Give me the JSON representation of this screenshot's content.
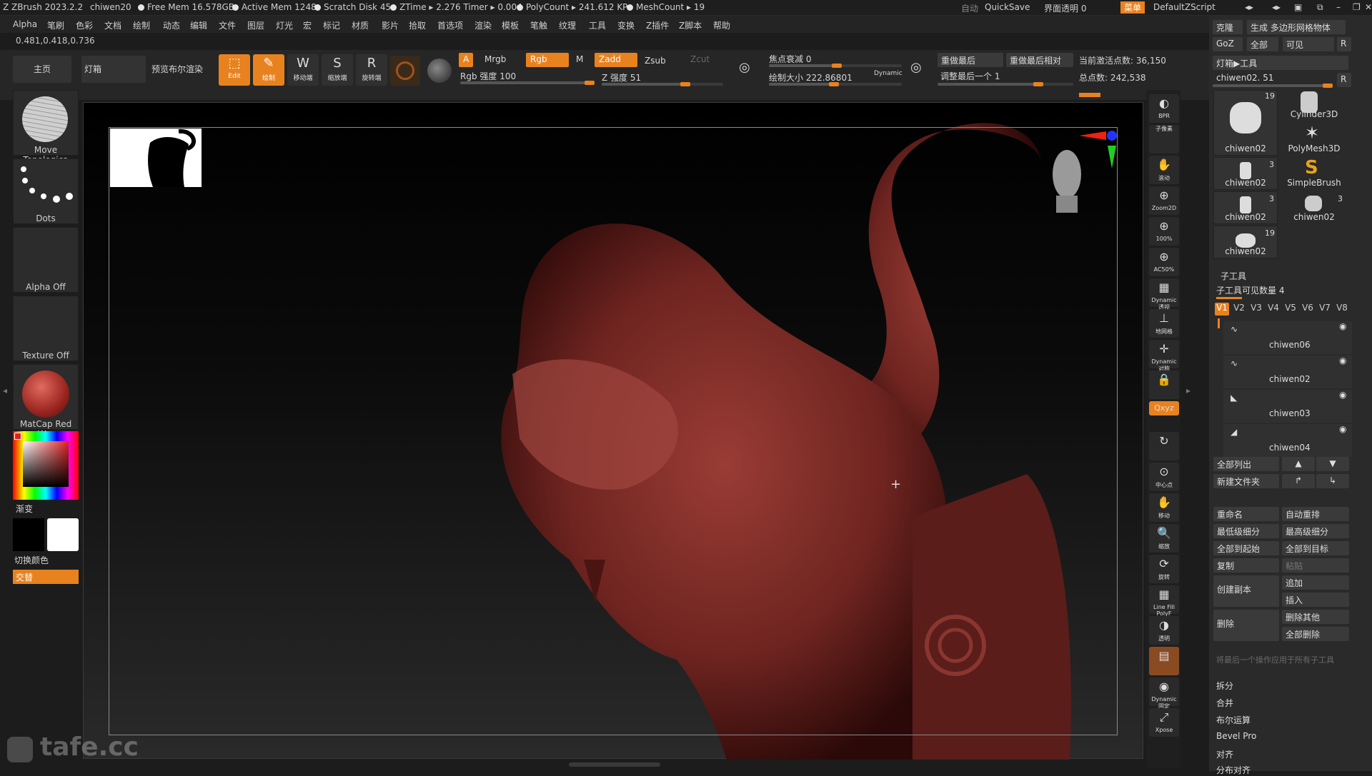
{
  "titlebar": {
    "app": "ZBrush 2023.2.2",
    "doc": "chiwen20",
    "free_mem": "Free Mem 16.578GB",
    "active_mem": "Active Mem 1248",
    "scratch": "Scratch Disk 45",
    "ztime": "ZTime ▸ 2.276 Timer ▸ 0.004",
    "polycount": "PolyCount ▸ 241.612 KP",
    "meshcount": "MeshCount ▸ 19",
    "auto": "自动",
    "quicksave": "QuickSave",
    "ui_opacity": "界面透明 0",
    "menu_btn": "菜单",
    "script": "DefaultZScript"
  },
  "menubar": [
    "Alpha",
    "笔刷",
    "色彩",
    "文档",
    "绘制",
    "动态",
    "编辑",
    "文件",
    "图层",
    "灯光",
    "宏",
    "标记",
    "材质",
    "影片",
    "拾取",
    "首选项",
    "渲染",
    "模板",
    "笔触",
    "纹理",
    "工具",
    "变换",
    "Z插件",
    "Z脚本",
    "帮助"
  ],
  "coords": "0.481,0.418,0.736",
  "toolbar": {
    "home": "主页",
    "lightbox": "灯箱",
    "preview_bool": "预览布尔渲染",
    "edit": "Edit",
    "draw": "绘制",
    "move": "移动端",
    "scale": "缩放端",
    "rotate": "旋转端",
    "a_chip": "A",
    "mrgb": "Mrgb",
    "rgb": "Rgb",
    "m": "M",
    "zadd": "Zadd",
    "zsub": "Zsub",
    "zcut": "Zcut",
    "rgb_intensity": "Rgb 强度 100",
    "z_intensity": "Z 强度 51",
    "focal_shift": "焦点衰减 0",
    "draw_size": "绘制大小 222.86801",
    "dynamic": "Dynamic",
    "replay_last": "重做最后",
    "replay_last_rel": "重做最后相对",
    "adjust_last": "调整最后一个 1",
    "active_points": "当前激活点数: 36,150",
    "total_points": "总点数: 242,538"
  },
  "left_shelf": [
    {
      "label": "Move Topologica",
      "icon": "brush-sphere-icon"
    },
    {
      "label": "Dots",
      "icon": "stroke-dots-icon"
    },
    {
      "label": "Alpha Off",
      "icon": "alpha-icon"
    },
    {
      "label": "Texture Off",
      "icon": "texture-icon"
    },
    {
      "label": "MatCap Red Wa:",
      "icon": "matcap-icon"
    }
  ],
  "color": {
    "gradient_label": "渐变",
    "switch_label": "切换颜色",
    "alternate_label": "交替",
    "main": "#000000",
    "secondary": "#ffffff"
  },
  "right_shelf": [
    "BPR",
    "子像素",
    "滚动",
    "Zoom2D",
    "100%",
    "AC50%",
    "Dynamic 透视",
    "地网格",
    "Dynamic 对称",
    "",
    "Qxyz",
    "",
    "中心点",
    "移动",
    "缩放",
    "旋转",
    "Line Fill PolyF",
    "透明",
    "",
    "Dynamic 固定",
    "Xpose"
  ],
  "panel": {
    "clone": "克隆",
    "make_polymesh": "生成 多边形网格物体",
    "goz": "GoZ",
    "all": "全部",
    "visible": "可见",
    "r": "R",
    "lightbox_tools": "灯箱▶工具",
    "current_tool": "chiwen02. 51",
    "tools": [
      {
        "name": "chiwen02",
        "count": "19"
      },
      {
        "name": "Cylinder3D",
        "count": ""
      },
      {
        "name": "PolyMesh3D",
        "count": ""
      },
      {
        "name": "chiwen02",
        "count": "3"
      },
      {
        "name": "SimpleBrush",
        "count": ""
      },
      {
        "name": "chiwen02",
        "count": "3"
      },
      {
        "name": "chiwen02",
        "count": "3"
      },
      {
        "name": "chiwen02",
        "count": "19"
      }
    ],
    "subtool_title": "子工具",
    "subtool_visible": "子工具可见数量 4",
    "v_tabs": [
      "V1",
      "V2",
      "V3",
      "V4",
      "V5",
      "V6",
      "V7",
      "V8"
    ],
    "subtools": [
      "chiwen06",
      "chiwen02",
      "chiwen03",
      "chiwen04"
    ],
    "list_all": "全部列出",
    "new_folder": "新建文件夹",
    "rename": "重命名",
    "auto_reorder": "自动重排",
    "lowest_sub": "最低级细分",
    "highest_sub": "最高级细分",
    "all_to_start": "全部到起始",
    "all_to_target": "全部到目标",
    "copy": "复制",
    "paste": "粘贴",
    "duplicate": "创建副本",
    "append": "追加",
    "insert": "插入",
    "delete": "删除",
    "delete_other": "删除其他",
    "delete_all": "全部删除",
    "hint": "将最后一个操作应用于所有子工具",
    "split": "拆分",
    "merge": "合并",
    "boolean": "布尔运算",
    "bevel": "Bevel Pro",
    "align": "对齐",
    "distribute": "分布对齐"
  },
  "watermark": "tafe.cc",
  "colors": {
    "accent": "#e8821f",
    "model": "#7a2a26"
  }
}
